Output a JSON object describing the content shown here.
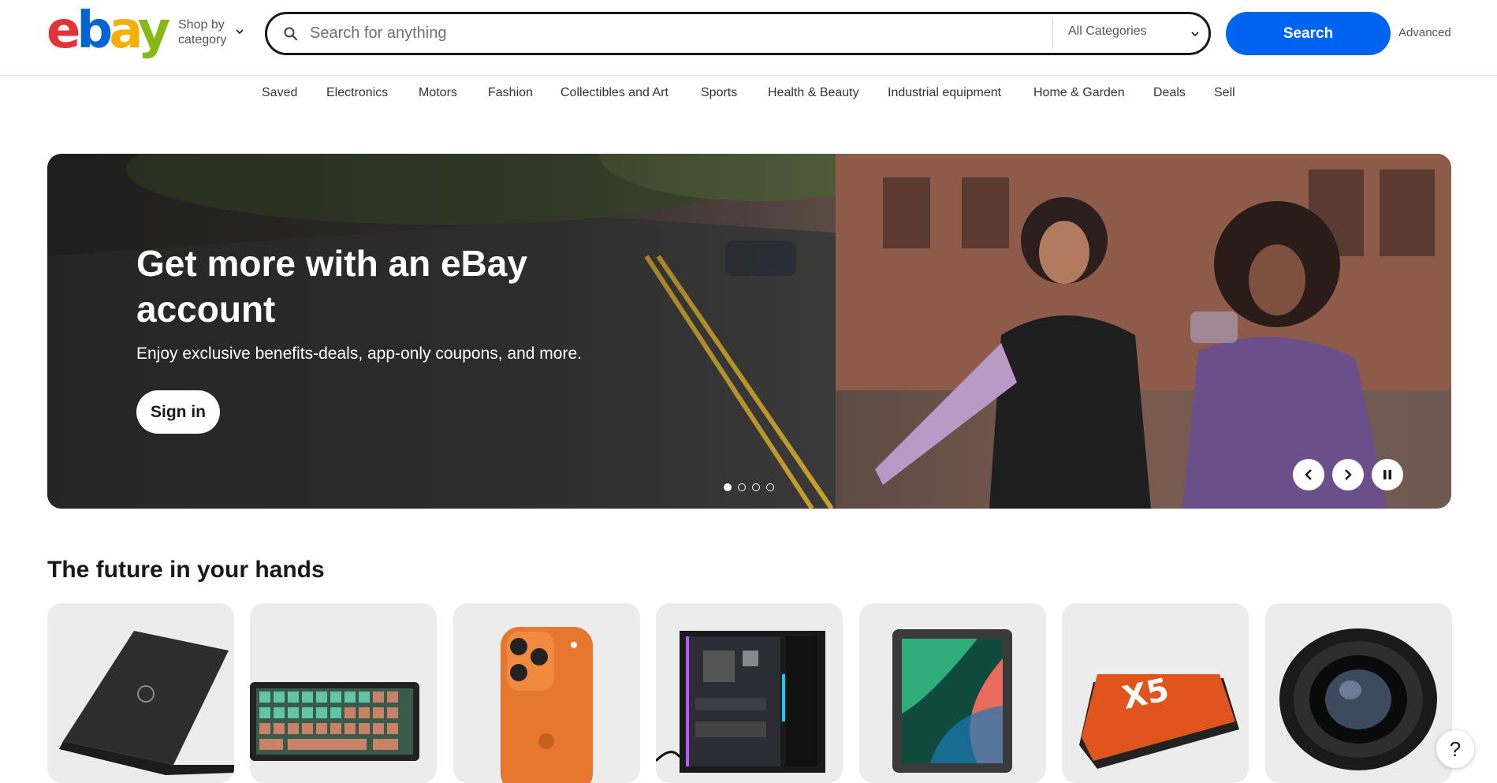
{
  "header": {
    "logo_letters": [
      "e",
      "b",
      "a",
      "y"
    ],
    "shop_by_label": "Shop by category",
    "search": {
      "placeholder": "Search for anything",
      "value": "",
      "category_selected": "All Categories"
    },
    "search_button_label": "Search",
    "advanced_label": "Advanced"
  },
  "nav": {
    "items": [
      "Saved",
      "Electronics",
      "Motors",
      "Fashion",
      "Collectibles and Art",
      "Sports",
      "Health & Beauty",
      "Industrial equipment",
      "Home & Garden",
      "Deals",
      "Sell"
    ]
  },
  "hero": {
    "title": "Get more with an eBay account",
    "subtitle": "Enjoy exclusive benefits-deals, app-only coupons, and more.",
    "cta_label": "Sign in",
    "carousel_slide_count": 4,
    "carousel_active_index": 0
  },
  "section": {
    "title": "The future in your hands",
    "cards": [
      {
        "icon": "laptop-icon"
      },
      {
        "icon": "keyboard-icon"
      },
      {
        "icon": "smartphone-icon"
      },
      {
        "icon": "desktop-tower-icon"
      },
      {
        "icon": "tablet-icon"
      },
      {
        "icon": "ssd-icon"
      },
      {
        "icon": "camera-lens-icon"
      }
    ]
  },
  "help": {
    "label": "?"
  },
  "colors": {
    "logo_e": "#e53238",
    "logo_b": "#0064d2",
    "logo_a": "#f5af02",
    "logo_y": "#86b817",
    "search_button": "#0064f0",
    "card_bg": "#ececec"
  }
}
